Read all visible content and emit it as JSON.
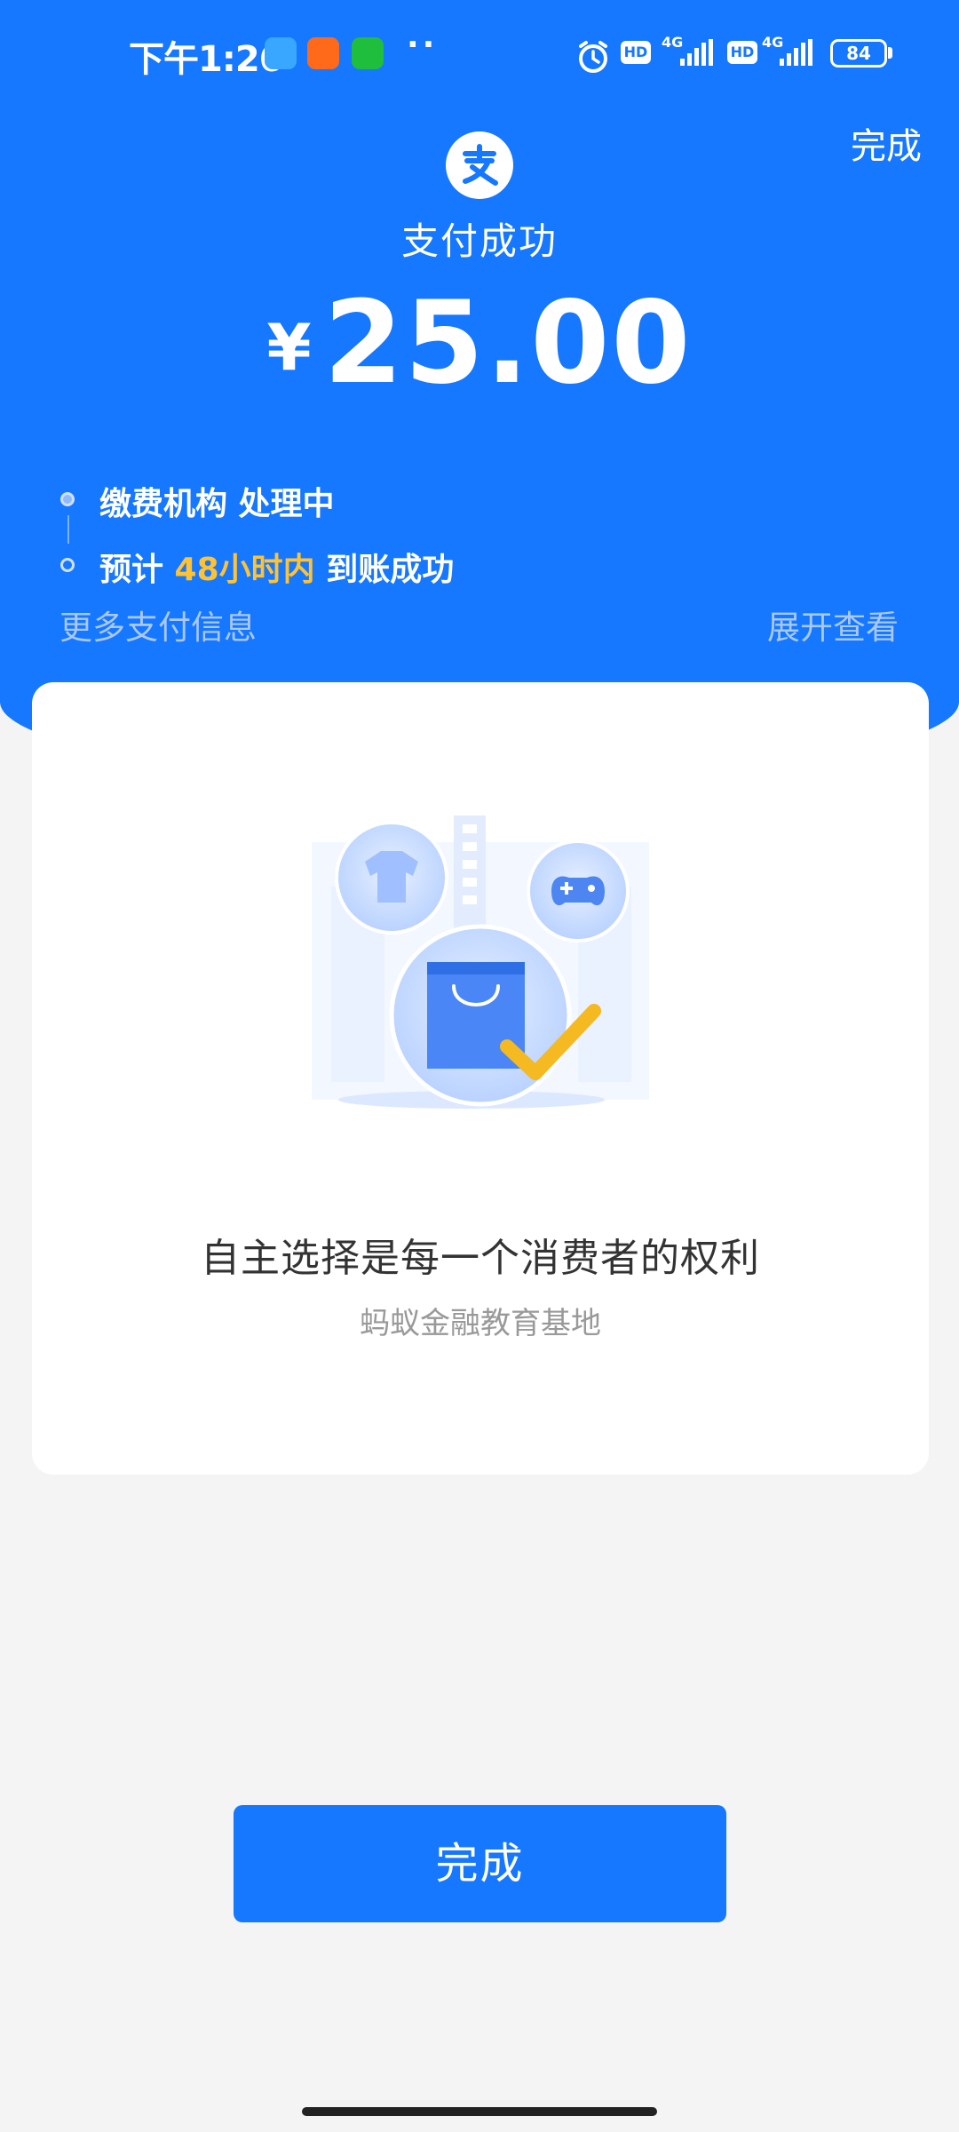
{
  "status_bar": {
    "time": "下午1:26",
    "network_1": "4G",
    "network_2": "4G",
    "hd_label": "HD",
    "battery": "84",
    "icons": [
      "message-app-icon",
      "taobao-app-icon",
      "wechat-app-icon",
      "more-dots-icon",
      "alarm-icon",
      "signal-icon",
      "battery-icon"
    ]
  },
  "header": {
    "done_label": "完成",
    "title": "支付成功",
    "currency": "¥",
    "amount": "25.00"
  },
  "progress": {
    "step1": "缴费机构 处理中",
    "step2_prefix": "预计 ",
    "step2_highlight": "48小时内",
    "step2_suffix": " 到账成功",
    "more_info": "更多支付信息",
    "expand": "展开查看"
  },
  "card": {
    "title": "自主选择是每一个消费者的权利",
    "subtitle": "蚂蚁金融教育基地"
  },
  "footer": {
    "done_button": "完成"
  },
  "colors": {
    "brand_blue": "#1677ff",
    "highlight_yellow": "#ffc233",
    "page_bg": "#f4f4f4"
  }
}
